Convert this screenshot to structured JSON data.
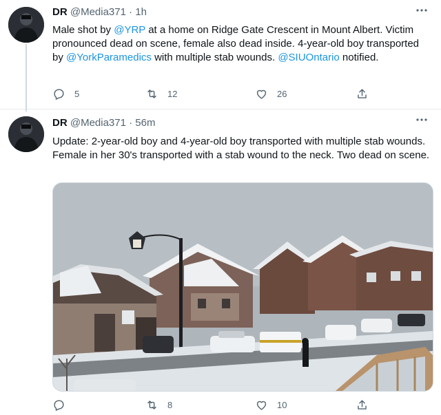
{
  "tweets": [
    {
      "name": "DR",
      "handle": "@Media371",
      "separator": "·",
      "time": "1h",
      "text_parts": [
        {
          "text": "Male shot by "
        },
        {
          "text": "@YRP",
          "link": true
        },
        {
          "text": " at a home on Ridge Gate Crescent in Mount Albert. Victim pronounced dead on scene, female also dead inside. 4-year-old boy transported by "
        },
        {
          "text": "@YorkParamedics",
          "link": true
        },
        {
          "text": " with multiple stab wounds. "
        },
        {
          "text": "@SIUOntario",
          "link": true
        },
        {
          "text": " notified."
        }
      ],
      "replies": "5",
      "retweets": "12",
      "likes": "26",
      "more_icon": "more-dots-icon"
    },
    {
      "name": "DR",
      "handle": "@Media371",
      "separator": "·",
      "time": "56m",
      "text": "Update: 2-year-old boy and 4-year-old boy transported with multiple stab wounds. Female in her 30's transported with a stab wound to the neck. Two dead on scene.",
      "retweets": "8",
      "likes": "10",
      "more_icon": "more-dots-icon"
    }
  ],
  "colors": {
    "link": "#1b95e0",
    "secondary_text": "#536471",
    "divider": "#e6ecf0"
  }
}
